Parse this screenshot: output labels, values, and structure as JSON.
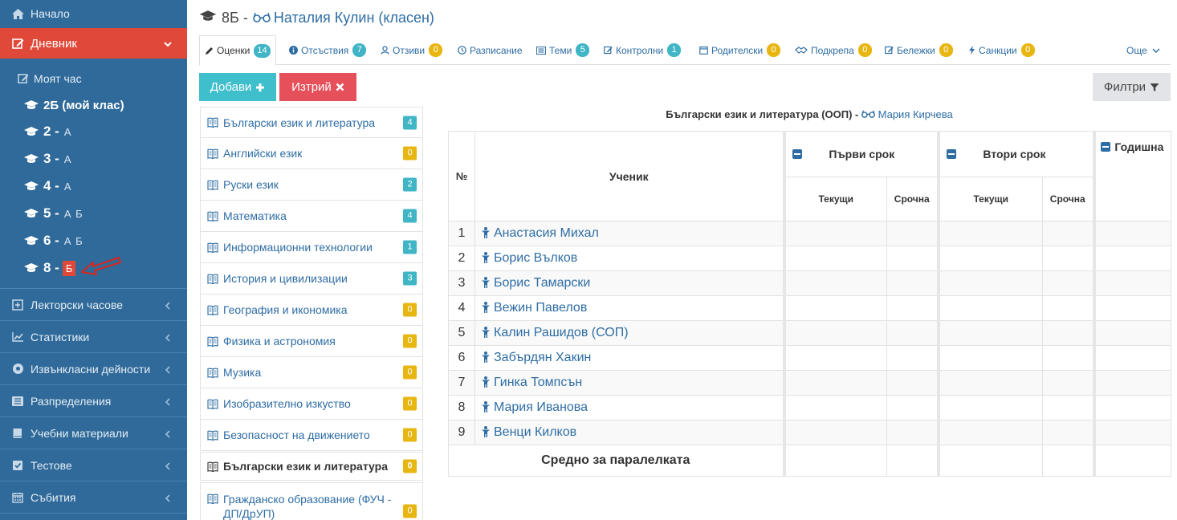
{
  "sidebar": {
    "home": "Начало",
    "diary": "Дневник",
    "my_hour": "Моят час",
    "classes": [
      {
        "label": "2Б (мой клас)",
        "letters": ""
      },
      {
        "label": "2 -",
        "letters": "А"
      },
      {
        "label": "3 -",
        "letters": "А"
      },
      {
        "label": "4 -",
        "letters": "А"
      },
      {
        "label": "5 -",
        "letters": "А Б"
      },
      {
        "label": "6 -",
        "letters": "А Б"
      },
      {
        "label": "8 -",
        "letters": "Б"
      }
    ],
    "sections": [
      {
        "label": "Лекторски часове",
        "icon": "plus-square-icon"
      },
      {
        "label": "Статистики",
        "icon": "line-chart-icon"
      },
      {
        "label": "Извънкласни дейности",
        "icon": "soccer-ball-icon"
      },
      {
        "label": "Разпределения",
        "icon": "list-icon"
      },
      {
        "label": "Учебни материали",
        "icon": "book-icon"
      },
      {
        "label": "Тестове",
        "icon": "check-square-icon"
      },
      {
        "label": "Събития",
        "icon": "calendar-icon"
      }
    ]
  },
  "header": {
    "class": "8Б -",
    "teacher": "Наталия Кулин (класен)"
  },
  "tabs": [
    {
      "label": "Оценки",
      "count": "14",
      "color": "teal"
    },
    {
      "label": "Отсъствия",
      "count": "7",
      "color": "teal"
    },
    {
      "label": "Отзиви",
      "count": "0",
      "color": "yellow"
    },
    {
      "label": "Разписание",
      "count": "",
      "color": ""
    },
    {
      "label": "Теми",
      "count": "5",
      "color": "teal"
    },
    {
      "label": "Контролни",
      "count": "1",
      "color": "teal"
    },
    {
      "label": "Родителски",
      "count": "0",
      "color": "yellow"
    },
    {
      "label": "Подкрепа",
      "count": "0",
      "color": "yellow"
    },
    {
      "label": "Бележки",
      "count": "0",
      "color": "yellow"
    },
    {
      "label": "Санкции",
      "count": "0",
      "color": "yellow"
    }
  ],
  "more_tab": "Още",
  "actions": {
    "add": "Добави",
    "delete": "Изтрий",
    "filters": "Филтри"
  },
  "subjects": [
    {
      "label": "Български език и литература",
      "count": "4",
      "color": "teal"
    },
    {
      "label": "Английски език",
      "count": "0",
      "color": "yellow"
    },
    {
      "label": "Руски език",
      "count": "2",
      "color": "teal"
    },
    {
      "label": "Математика",
      "count": "4",
      "color": "teal"
    },
    {
      "label": "Информационни технологии",
      "count": "1",
      "color": "teal"
    },
    {
      "label": "История и цивилизации",
      "count": "3",
      "color": "teal"
    },
    {
      "label": "География и икономика",
      "count": "0",
      "color": "yellow"
    },
    {
      "label": "Физика и астрономия",
      "count": "0",
      "color": "yellow"
    },
    {
      "label": "Музика",
      "count": "0",
      "color": "yellow"
    },
    {
      "label": "Изобразително изкуство",
      "count": "0",
      "color": "yellow"
    },
    {
      "label": "Безопасност на движението",
      "count": "0",
      "color": "yellow"
    },
    {
      "label": "Български език и литература",
      "count": "0",
      "color": "yellow"
    },
    {
      "label": "Гражданско образование (ФУЧ - ДП/ДрУП)",
      "count": "0",
      "color": "yellow"
    }
  ],
  "table": {
    "caption_subject": "Български език и литература (ООП) -",
    "caption_teacher": "Мария Кирчева",
    "col_num": "№",
    "col_student": "Ученик",
    "term1": "Първи срок",
    "term2": "Втори срок",
    "annual": "Годишна",
    "current": "Текущи",
    "term_grade": "Срочна",
    "students": [
      {
        "n": "1",
        "name": "Анастасия Михал"
      },
      {
        "n": "2",
        "name": "Борис Вълков"
      },
      {
        "n": "3",
        "name": "Борис Тамарски"
      },
      {
        "n": "4",
        "name": "Вежин Павелов"
      },
      {
        "n": "5",
        "name": "Калин Рашидов (СОП)"
      },
      {
        "n": "6",
        "name": "Забърдян Хакин"
      },
      {
        "n": "7",
        "name": "Гинка Томпсън"
      },
      {
        "n": "8",
        "name": "Мария Иванова"
      },
      {
        "n": "9",
        "name": "Венци Килков"
      }
    ],
    "average": "Средно за паралелката"
  },
  "colors": {
    "sidebar": "#2f6a9a",
    "active": "#e0493a",
    "teal": "#3fb5c6",
    "yellow": "#e8b611",
    "link": "#2e6da4"
  }
}
